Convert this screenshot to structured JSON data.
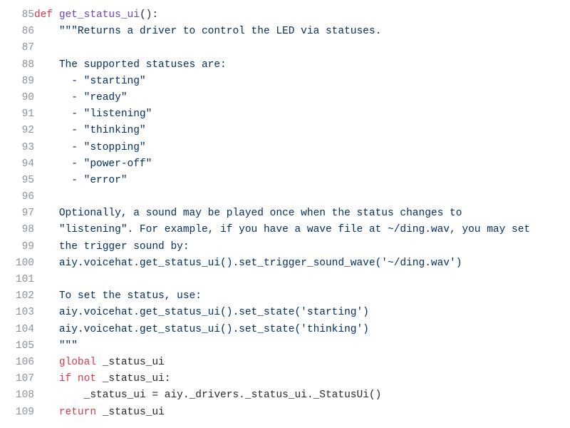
{
  "lines": [
    {
      "num": 85,
      "indent": 0,
      "tokens": [
        [
          "kw",
          "def "
        ],
        [
          "fn",
          "get_status_ui"
        ],
        [
          "op",
          "():"
        ]
      ]
    },
    {
      "num": 86,
      "indent": 1,
      "tokens": [
        [
          "str",
          "\"\"\"Returns a driver to control the LED via statuses."
        ]
      ]
    },
    {
      "num": 87,
      "indent": 0,
      "tokens": [
        [
          "str",
          ""
        ]
      ]
    },
    {
      "num": 88,
      "indent": 1,
      "tokens": [
        [
          "str",
          "The supported statuses are:"
        ]
      ]
    },
    {
      "num": 89,
      "indent": 1,
      "tokens": [
        [
          "str",
          "  - \"starting\""
        ]
      ]
    },
    {
      "num": 90,
      "indent": 1,
      "tokens": [
        [
          "str",
          "  - \"ready\""
        ]
      ]
    },
    {
      "num": 91,
      "indent": 1,
      "tokens": [
        [
          "str",
          "  - \"listening\""
        ]
      ]
    },
    {
      "num": 92,
      "indent": 1,
      "tokens": [
        [
          "str",
          "  - \"thinking\""
        ]
      ]
    },
    {
      "num": 93,
      "indent": 1,
      "tokens": [
        [
          "str",
          "  - \"stopping\""
        ]
      ]
    },
    {
      "num": 94,
      "indent": 1,
      "tokens": [
        [
          "str",
          "  - \"power-off\""
        ]
      ]
    },
    {
      "num": 95,
      "indent": 1,
      "tokens": [
        [
          "str",
          "  - \"error\""
        ]
      ]
    },
    {
      "num": 96,
      "indent": 0,
      "tokens": [
        [
          "str",
          ""
        ]
      ]
    },
    {
      "num": 97,
      "indent": 1,
      "tokens": [
        [
          "str",
          "Optionally, a sound may be played once when the status changes to"
        ]
      ]
    },
    {
      "num": 98,
      "indent": 1,
      "tokens": [
        [
          "str",
          "\"listening\". For example, if you have a wave file at ~/ding.wav, you may set"
        ]
      ]
    },
    {
      "num": 99,
      "indent": 1,
      "tokens": [
        [
          "str",
          "the trigger sound by:"
        ]
      ]
    },
    {
      "num": 100,
      "indent": 1,
      "tokens": [
        [
          "str",
          "aiy.voicehat.get_status_ui().set_trigger_sound_wave('~/ding.wav')"
        ]
      ]
    },
    {
      "num": 101,
      "indent": 0,
      "tokens": [
        [
          "str",
          ""
        ]
      ]
    },
    {
      "num": 102,
      "indent": 1,
      "tokens": [
        [
          "str",
          "To set the status, use:"
        ]
      ]
    },
    {
      "num": 103,
      "indent": 1,
      "tokens": [
        [
          "str",
          "aiy.voicehat.get_status_ui().set_state('starting')"
        ]
      ]
    },
    {
      "num": 104,
      "indent": 1,
      "tokens": [
        [
          "str",
          "aiy.voicehat.get_status_ui().set_state('thinking')"
        ]
      ]
    },
    {
      "num": 105,
      "indent": 1,
      "tokens": [
        [
          "str",
          "\"\"\""
        ]
      ]
    },
    {
      "num": 106,
      "indent": 1,
      "tokens": [
        [
          "kw",
          "global"
        ],
        [
          "op",
          " _status_ui"
        ]
      ]
    },
    {
      "num": 107,
      "indent": 1,
      "tokens": [
        [
          "kw",
          "if"
        ],
        [
          "op",
          " "
        ],
        [
          "kw",
          "not"
        ],
        [
          "op",
          " _status_ui:"
        ]
      ]
    },
    {
      "num": 108,
      "indent": 2,
      "tokens": [
        [
          "op",
          "_status_ui = aiy._drivers._status_ui._StatusUi()"
        ]
      ]
    },
    {
      "num": 109,
      "indent": 1,
      "tokens": [
        [
          "kw",
          "return"
        ],
        [
          "op",
          " _status_ui"
        ]
      ]
    }
  ],
  "indent_unit": "    "
}
